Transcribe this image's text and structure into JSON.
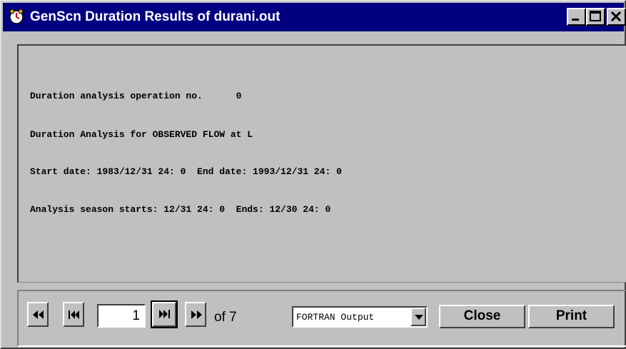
{
  "window": {
    "title": "GenScn Duration Results of durani.out",
    "icon": "clock-icon"
  },
  "titlebar_buttons": [
    "minimize-icon",
    "maximize-icon",
    "close-icon"
  ],
  "output": {
    "lines": [
      "Duration analysis operation no.      0",
      "Duration Analysis for OBSERVED FLOW at L",
      "Start date: 1983/12/31 24: 0  End date: 1993/12/31 24: 0",
      "Analysis season starts: 12/31 24: 0  Ends: 12/30 24: 0"
    ]
  },
  "navigation": {
    "page_value": "1",
    "page_total_label": "of 7",
    "icons": [
      "rewind-icon",
      "skip-back-icon",
      "skip-forward-icon",
      "fast-forward-icon"
    ]
  },
  "format_select": {
    "selected": "FORTRAN Output"
  },
  "buttons": {
    "close_label": "Close",
    "print_label": "Print"
  }
}
